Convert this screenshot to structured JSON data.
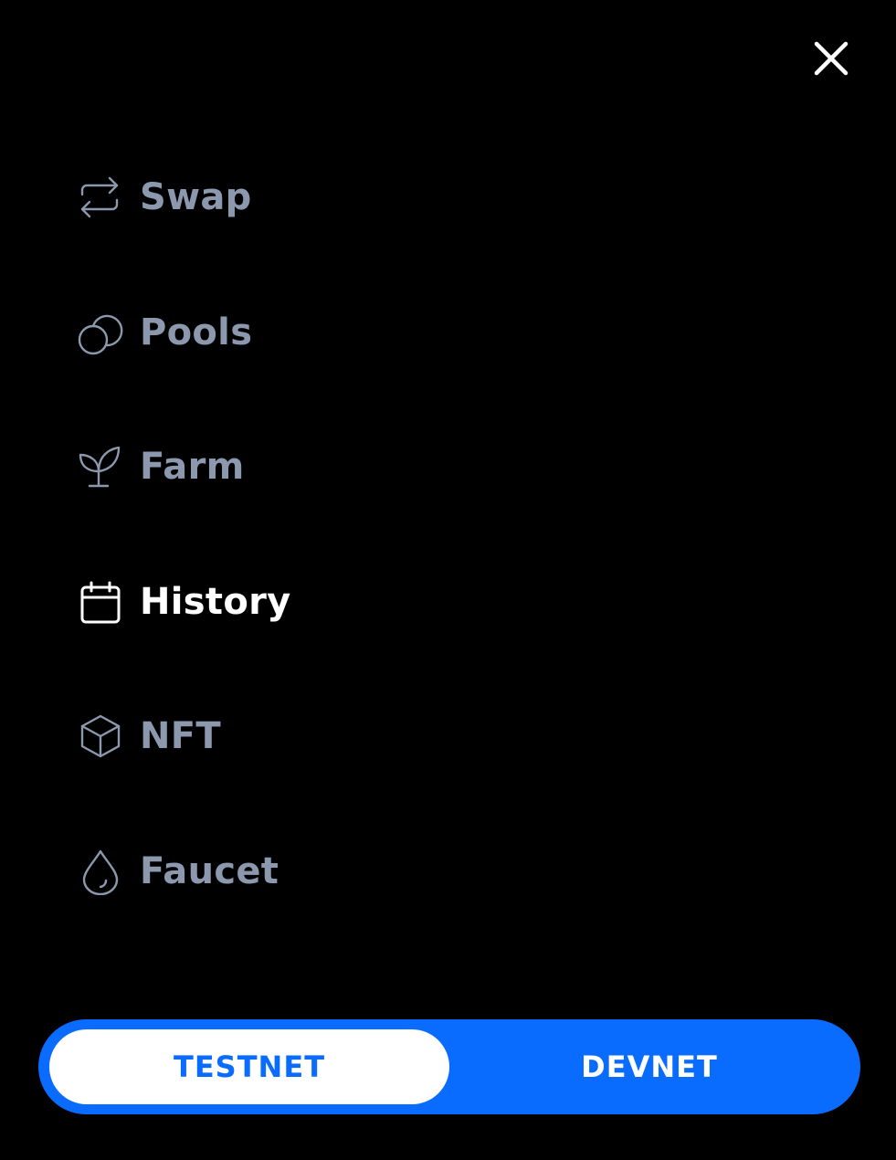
{
  "close": {
    "icon": "close-icon"
  },
  "menu": {
    "items": [
      {
        "label": "Swap",
        "icon": "swap-arrows-icon",
        "active": false
      },
      {
        "label": "Pools",
        "icon": "pools-circles-icon",
        "active": false
      },
      {
        "label": "Farm",
        "icon": "sprout-icon",
        "active": false
      },
      {
        "label": "History",
        "icon": "calendar-icon",
        "active": true
      },
      {
        "label": "NFT",
        "icon": "cube-icon",
        "active": false
      },
      {
        "label": "Faucet",
        "icon": "droplet-icon",
        "active": false
      }
    ]
  },
  "network": {
    "options": [
      "TESTNET",
      "DEVNET"
    ],
    "selected": "TESTNET"
  },
  "colors": {
    "background": "#000000",
    "inactive_text": "#8b98ad",
    "active_text": "#ffffff",
    "accent": "#0a6cff"
  }
}
